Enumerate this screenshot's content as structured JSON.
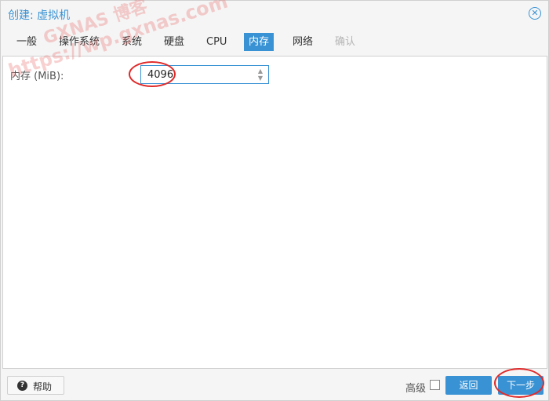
{
  "window": {
    "title": "创建: 虚拟机",
    "close_icon": "close-circle-icon"
  },
  "tabs": [
    {
      "label": "一般",
      "state": "normal"
    },
    {
      "label": "操作系统",
      "state": "normal"
    },
    {
      "label": "系统",
      "state": "normal"
    },
    {
      "label": "硬盘",
      "state": "normal"
    },
    {
      "label": "CPU",
      "state": "normal"
    },
    {
      "label": "内存",
      "state": "active"
    },
    {
      "label": "网络",
      "state": "normal"
    },
    {
      "label": "确认",
      "state": "disabled"
    }
  ],
  "memory": {
    "label": "内存 (MiB):",
    "value": "4096"
  },
  "footer": {
    "help_label": "帮助",
    "advanced_label": "高级",
    "advanced_checked": false,
    "back_label": "返回",
    "next_label": "下一步"
  },
  "watermark": {
    "line1": "GXNAS 博客",
    "line2": "https://wp.gxnas.com"
  },
  "colors": {
    "accent": "#3892d4",
    "annotation": "#e02a2a"
  }
}
